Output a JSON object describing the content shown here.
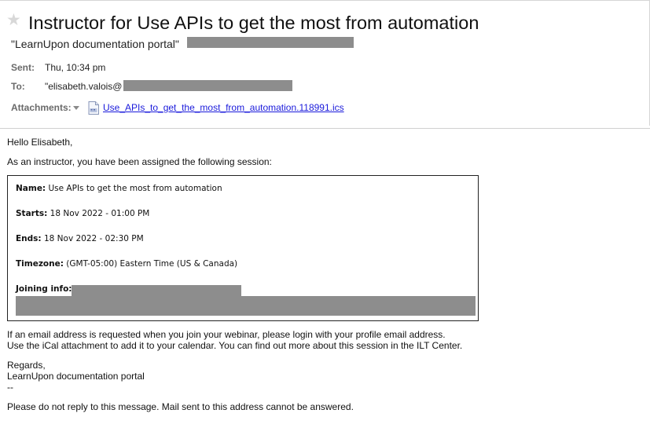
{
  "email": {
    "subject": "Instructor for Use APIs to get the most from automation",
    "from": "\"LearnUpon documentation portal\" ",
    "sent_label": "Sent:",
    "sent_value": "Thu, 10:34 pm",
    "to_label": "To:",
    "to_value": "\"elisabeth.valois@",
    "attachments_label": "Attachments:",
    "attachment_name": "Use_APIs_to_get_the_most_from_automation.118991.ics",
    "icons": {
      "star": "star-icon",
      "attachment": "calendar-file-icon",
      "dropdown": "chevron-down-icon"
    }
  },
  "body": {
    "greeting": "Hello Elisabeth,",
    "intro": "As an instructor, you have been assigned the following session:",
    "session": {
      "name_label": "Name:",
      "name_value": " Use APIs to get the most from automation",
      "starts_label": "Starts:",
      "starts_value": " 18 Nov 2022 - 01:00 PM",
      "ends_label": "Ends:",
      "ends_value": " 18 Nov 2022 - 02:30 PM",
      "timezone_label": "Timezone:",
      "timezone_value": " (GMT-05:00) Eastern Time (US & Canada)",
      "joining_label": "Joining info:"
    },
    "note_line1": "If an email address is requested when you join your webinar, please login with your profile email address.",
    "note_line2": "Use the iCal attachment to add it to your calendar. You can find out more about this session in the ILT Center.",
    "regards": "Regards,",
    "signature": "LearnUpon documentation portal",
    "sig_sep": "--",
    "footer": "Please do not reply to this message. Mail sent to this address cannot be answered."
  }
}
